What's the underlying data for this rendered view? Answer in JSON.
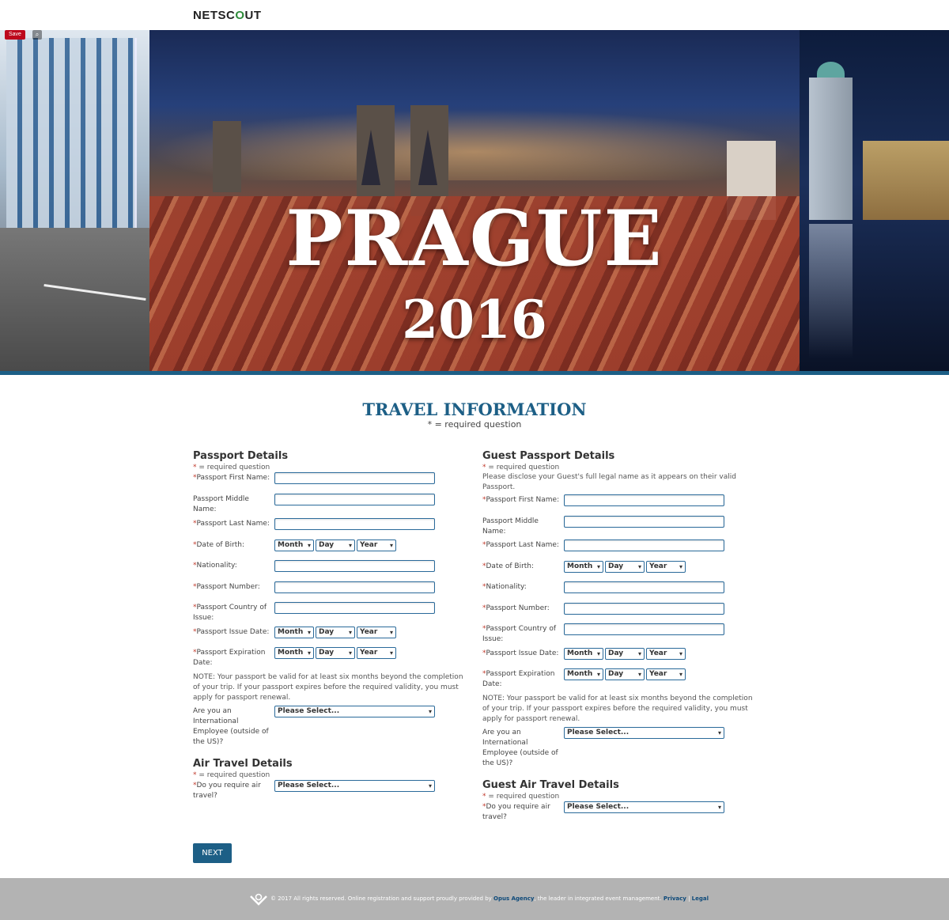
{
  "header": {
    "logo_pre": "NETSC",
    "logo_o": "O",
    "logo_post": "UT"
  },
  "pinterest": {
    "save_label": "Save"
  },
  "hero": {
    "title": "PRAGUE",
    "year": "2016"
  },
  "page": {
    "title": "TRAVEL INFORMATION",
    "subtitle": "* = required question"
  },
  "left": {
    "passport": {
      "heading": "Passport Details",
      "req_star": "*",
      "req_text": " = required question",
      "first_name": "Passport First Name:",
      "middle_name": "Passport Middle Name:",
      "last_name": "Passport Last Name:",
      "dob": "Date of Birth:",
      "nationality": "Nationality:",
      "number": "Passport Number:",
      "country": "Passport Country of Issue:",
      "issue_date": "Passport Issue Date:",
      "exp_date": "Passport Expiration Date:",
      "note": "NOTE: Your passport be valid for at least six months beyond the completion of your trip. If your passport expires before the required validity, you must apply for passport renewal.",
      "intl": "Are you an International Employee (outside of the US)?"
    },
    "air": {
      "heading": "Air Travel Details",
      "req_star": "*",
      "req_text": " = required question",
      "require_air": "Do you require air travel?"
    }
  },
  "right": {
    "passport": {
      "heading": "Guest Passport Details",
      "req_star": "*",
      "req_text": " = required question",
      "intro": "Please disclose your Guest's full legal name as it appears on their valid Passport.",
      "first_name": "Passport First Name:",
      "middle_name": "Passport Middle Name:",
      "last_name": "Passport Last Name:",
      "dob": "Date of Birth:",
      "nationality": "Nationality:",
      "number": "Passport Number:",
      "country": "Passport Country of Issue:",
      "issue_date": "Passport Issue Date:",
      "exp_date": "Passport Expiration Date:",
      "note": "NOTE: Your passport be valid for at least six months beyond the completion of your trip. If your passport expires before the required validity, you must apply for passport renewal.",
      "intl": "Are you an International Employee (outside of the US)?"
    },
    "air": {
      "heading": "Guest Air Travel Details",
      "req_star": "*",
      "req_text": " = required question",
      "require_air": "Do you require air travel?"
    }
  },
  "selects": {
    "month": "Month",
    "day": "Day",
    "year": "Year",
    "please": "Please Select..."
  },
  "star": "*",
  "buttons": {
    "next": "NEXT"
  },
  "footer": {
    "text": "© 2017 All rights reserved. Online registration and support proudly provided by ",
    "agency": "Opus Agency",
    "tail": ", the leader in integrated event management. ",
    "privacy": "Privacy",
    "sep": " | ",
    "legal": "Legal"
  },
  "colors": {
    "accent": "#1d5f86",
    "required": "#c0392b",
    "footer_bg": "#b3b3b3"
  }
}
